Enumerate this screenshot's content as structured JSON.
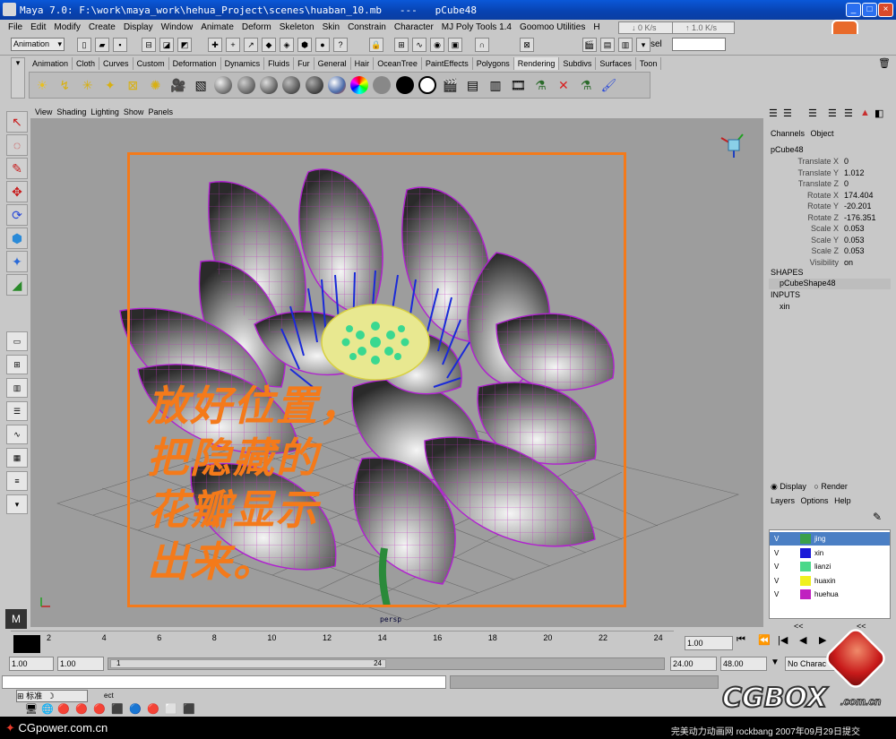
{
  "window": {
    "title": "Maya 7.0: F:\\work\\maya_work\\hehua_Project\\scenes\\huaban_10.mb   ---   pCube48"
  },
  "menu": [
    "File",
    "Edit",
    "Modify",
    "Create",
    "Display",
    "Window",
    "Animate",
    "Deform",
    "Skeleton",
    "Skin",
    "Constrain",
    "Character",
    "MJ Poly Tools 1.4",
    "Goomoo Utilities",
    "H"
  ],
  "net": {
    "down": "0 K/s",
    "up": "1.0 K/s"
  },
  "status": {
    "mode": "Animation",
    "sel_label": "sel"
  },
  "shelf_tabs": [
    "Animation",
    "Cloth",
    "Curves",
    "Custom",
    "Deformation",
    "Dynamics",
    "Fluids",
    "Fur",
    "General",
    "Hair",
    "OceanTree",
    "PaintEffects",
    "Polygons",
    "Rendering",
    "Subdivs",
    "Surfaces",
    "Toon"
  ],
  "shelf_active": "Rendering",
  "panel_menu": [
    "View",
    "Shading",
    "Lighting",
    "Show",
    "Panels"
  ],
  "viewport": {
    "camera": "persp",
    "overlay_lines": [
      "放好位置，",
      "把隐藏的",
      "花瓣显示",
      "出来。"
    ]
  },
  "channel_box": {
    "tabs": [
      "Channels",
      "Object"
    ],
    "object": "pCube48",
    "attributes": [
      {
        "name": "Translate X",
        "value": "0"
      },
      {
        "name": "Translate Y",
        "value": "1.012"
      },
      {
        "name": "Translate Z",
        "value": "0"
      },
      {
        "name": "Rotate X",
        "value": "174.404"
      },
      {
        "name": "Rotate Y",
        "value": "-20.201"
      },
      {
        "name": "Rotate Z",
        "value": "-176.351"
      },
      {
        "name": "Scale X",
        "value": "0.053"
      },
      {
        "name": "Scale Y",
        "value": "0.053"
      },
      {
        "name": "Scale Z",
        "value": "0.053"
      },
      {
        "name": "Visibility",
        "value": "on"
      }
    ],
    "shapes_header": "SHAPES",
    "shape": "pCubeShape48",
    "inputs_header": "INPUTS",
    "input": "xin"
  },
  "layer_editor": {
    "display_label": "Display",
    "render_label": "Render",
    "menu": [
      "Layers",
      "Options",
      "Help"
    ],
    "layers": [
      {
        "v": "V",
        "name": "jing",
        "color": "#3aa04a",
        "selected": true
      },
      {
        "v": "V",
        "name": "xin",
        "color": "#1a1ad8",
        "selected": false
      },
      {
        "v": "V",
        "name": "lianzi",
        "color": "#4ad88a",
        "selected": false
      },
      {
        "v": "V",
        "name": "huaxin",
        "color": "#f0f020",
        "selected": false
      },
      {
        "v": "V",
        "name": "huehua",
        "color": "#c020c0",
        "selected": false
      }
    ],
    "scroll_left": "<<",
    "scroll_right": "<<"
  },
  "timeline": {
    "ticks": [
      "2",
      "4",
      "6",
      "8",
      "10",
      "12",
      "14",
      "16",
      "18",
      "20",
      "22",
      "24"
    ],
    "current_field": "1.00"
  },
  "range": {
    "start": "1.00",
    "start2": "1.00",
    "slider_start": "1",
    "slider_end": "24",
    "end": "24.00",
    "end2": "48.00",
    "character": "No Charac"
  },
  "taskbar": {
    "ime": "标准",
    "help_frag": "ect"
  },
  "footer": {
    "left": "CGpower.com.cn",
    "right": "完美动力动画网 rockbang 2007年09月29日提交"
  },
  "watermark": {
    "text": "CGBOX",
    "sub": ".com.cn"
  }
}
